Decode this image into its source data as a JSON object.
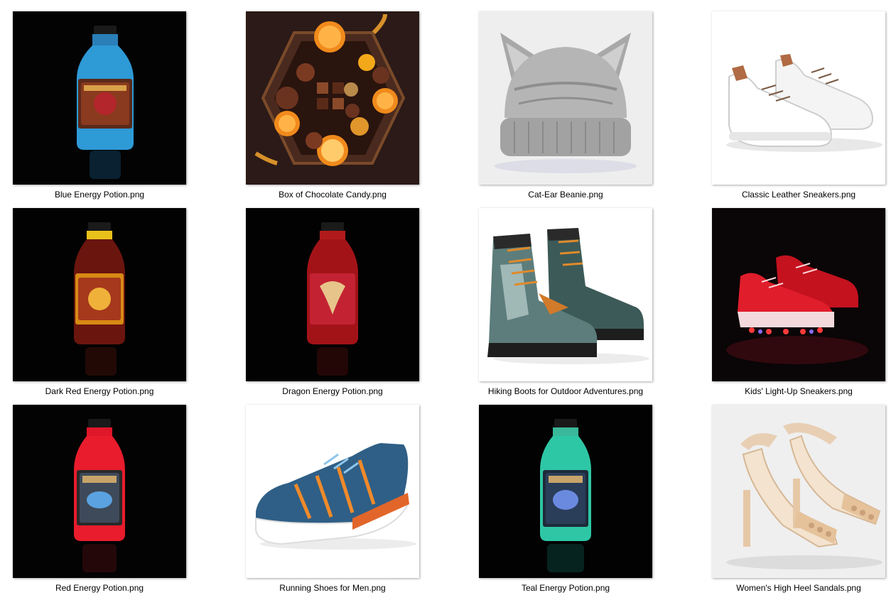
{
  "files": [
    {
      "name": "Blue Energy Potion.png",
      "icon": "blue-potion-bottle-thumbnail"
    },
    {
      "name": "Box of Chocolate Candy.png",
      "icon": "chocolate-box-thumbnail"
    },
    {
      "name": "Cat-Ear Beanie.png",
      "icon": "cat-ear-beanie-thumbnail"
    },
    {
      "name": "Classic Leather Sneakers.png",
      "icon": "white-sneakers-thumbnail"
    },
    {
      "name": "Dark Red Energy Potion.png",
      "icon": "dark-red-potion-bottle-thumbnail"
    },
    {
      "name": "Dragon Energy Potion.png",
      "icon": "dragon-potion-bottle-thumbnail"
    },
    {
      "name": "Hiking Boots for Outdoor Adventures.png",
      "icon": "hiking-boots-thumbnail"
    },
    {
      "name": "Kids' Light-Up Sneakers.png",
      "icon": "light-up-sneakers-thumbnail"
    },
    {
      "name": "Red Energy Potion.png",
      "icon": "red-potion-bottle-thumbnail"
    },
    {
      "name": "Running Shoes for Men.png",
      "icon": "running-shoe-thumbnail"
    },
    {
      "name": "Teal Energy Potion.png",
      "icon": "teal-potion-bottle-thumbnail"
    },
    {
      "name": "Women's High Heel Sandals.png",
      "icon": "high-heel-sandals-thumbnail"
    }
  ]
}
